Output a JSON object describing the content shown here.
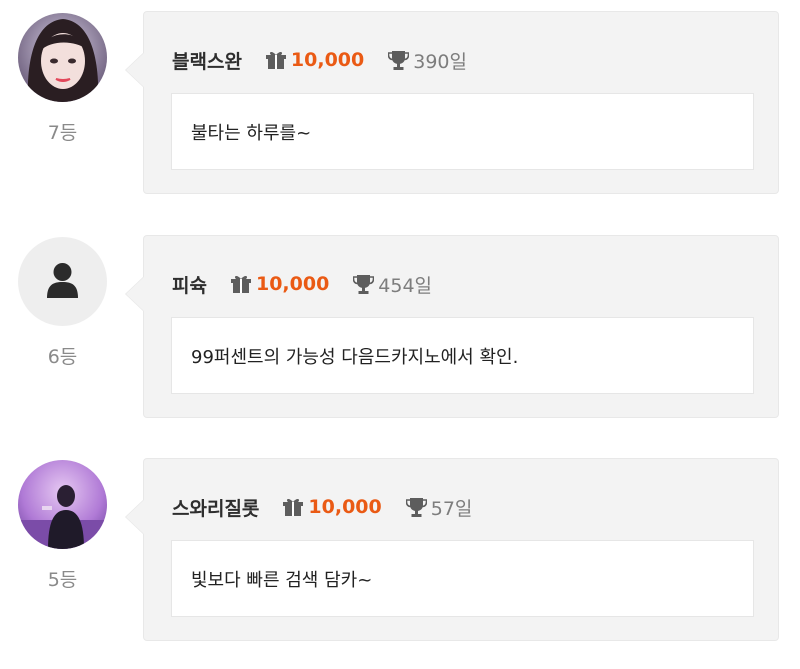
{
  "accent_color": "#ea5a14",
  "entries": [
    {
      "rank": "7등",
      "nickname": "블랙스완",
      "points": "10,000",
      "days": "390일",
      "message": "불타는 하루를~",
      "avatar": "photo-avatar-woman"
    },
    {
      "rank": "6등",
      "nickname": "피슉",
      "points": "10,000",
      "days": "454일",
      "message": "99퍼센트의 가능성 다음드카지노에서 확인.",
      "avatar": "default-user-icon"
    },
    {
      "rank": "5등",
      "nickname": "스와리질롯",
      "points": "10,000",
      "days": "57일",
      "message": "빛보다 빠른 검색 담카~",
      "avatar": "photo-avatar-man-purple"
    }
  ]
}
